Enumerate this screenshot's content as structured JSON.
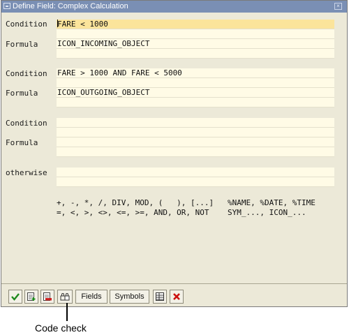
{
  "window": {
    "title": "Define Field: Complex Calculation",
    "close_glyph": "×"
  },
  "rows": [
    {
      "condition_label": "Condition",
      "condition_value": "FARE < 1000",
      "formula_label": "Formula",
      "formula_value": "ICON_INCOMING_OBJECT"
    },
    {
      "condition_label": "Condition",
      "condition_value": "FARE > 1000 AND FARE < 5000",
      "formula_label": "Formula",
      "formula_value": "ICON_OUTGOING_OBJECT"
    },
    {
      "condition_label": "Condition",
      "condition_value": "",
      "formula_label": "Formula",
      "formula_value": ""
    }
  ],
  "otherwise": {
    "label": "otherwise",
    "value": ""
  },
  "operators": {
    "line1": "+, -, *, /, DIV, MOD, (   ), [...]",
    "line2": "=, <, >, <>, <=, >=, AND, OR, NOT"
  },
  "symbols": {
    "line1": "%NAME, %DATE, %TIME",
    "line2": "SYM_..., ICON_..."
  },
  "toolbar": {
    "fields_label": "Fields",
    "symbols_label": "Symbols",
    "icons": [
      "checkmark-icon",
      "insert-line-icon",
      "delete-line-icon",
      "code-check-icon",
      "table-icon",
      "cancel-icon"
    ]
  },
  "callout": {
    "label": "Code check"
  },
  "colors": {
    "title_bar": "#7a8fb4",
    "field_bg": "#fffbe6",
    "active_field_bg": "#fbe49b",
    "dialog_bg": "#ece9d8"
  }
}
